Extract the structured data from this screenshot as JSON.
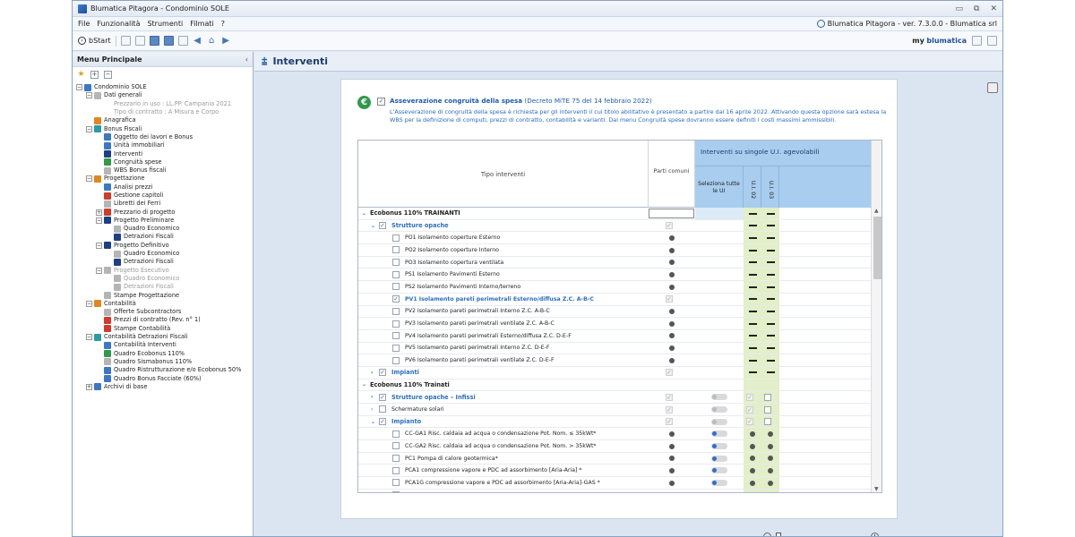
{
  "window": {
    "title": "Blumatica Pitagora - Condominio SOLE"
  },
  "menu": {
    "items": [
      "File",
      "Funzionalità",
      "Strumenti",
      "Filmati",
      "?"
    ],
    "version": "Blumatica Pitagora - ver. 7.3.0.0 - Blumatica srl"
  },
  "toolbar": {
    "bstart": "bStart",
    "my": "my",
    "brand": "blumatica"
  },
  "left_panel": {
    "title": "Menu Principale",
    "tree": [
      {
        "label": "Condominio SOLE",
        "indent": 0,
        "exp": "-",
        "icon": "c-blue"
      },
      {
        "label": "Dati generali",
        "indent": 1,
        "exp": "-",
        "icon": "c-gray"
      },
      {
        "label": "Prezzario in uso : LL.PP. Campania 2021",
        "indent": 3,
        "exp": "",
        "icon": "",
        "dis": true
      },
      {
        "label": "Tipo di contratto : A Misura e Corpo",
        "indent": 3,
        "exp": "",
        "icon": "",
        "dis": true
      },
      {
        "label": "Anagrafica",
        "indent": 1,
        "exp": "",
        "icon": "c-orange"
      },
      {
        "label": "Bonus Fiscali",
        "indent": 1,
        "exp": "-",
        "icon": "c-teal"
      },
      {
        "label": "Oggetto dei lavori e Bonus",
        "indent": 2,
        "exp": "",
        "icon": "c-blue"
      },
      {
        "label": "Unità immobiliari",
        "indent": 2,
        "exp": "",
        "icon": "c-blue"
      },
      {
        "label": "Interventi",
        "indent": 2,
        "exp": "",
        "icon": "c-navy"
      },
      {
        "label": "Congruità spese",
        "indent": 2,
        "exp": "",
        "icon": "c-green"
      },
      {
        "label": "WBS Bonus fiscali",
        "indent": 2,
        "exp": "",
        "icon": "c-gray"
      },
      {
        "label": "Progettazione",
        "indent": 1,
        "exp": "-",
        "icon": "c-orange"
      },
      {
        "label": "Analisi prezzi",
        "indent": 2,
        "exp": "",
        "icon": "c-blue"
      },
      {
        "label": "Gestione capitoli",
        "indent": 2,
        "exp": "",
        "icon": "c-red"
      },
      {
        "label": "Libretti dei Ferri",
        "indent": 2,
        "exp": "",
        "icon": "c-gray"
      },
      {
        "label": "Prezzario di progetto",
        "indent": 2,
        "exp": "+",
        "icon": "c-red"
      },
      {
        "label": "Progetto Preliminare",
        "indent": 2,
        "exp": "-",
        "icon": "c-navy"
      },
      {
        "label": "Quadro Economico",
        "indent": 3,
        "exp": "",
        "icon": "c-gray"
      },
      {
        "label": "Detrazioni Fiscali",
        "indent": 3,
        "exp": "",
        "icon": "c-navy"
      },
      {
        "label": "Progetto Definitivo",
        "indent": 2,
        "exp": "-",
        "icon": "c-navy"
      },
      {
        "label": "Quadro Economico",
        "indent": 3,
        "exp": "",
        "icon": "c-gray"
      },
      {
        "label": "Detrazioni Fiscali",
        "indent": 3,
        "exp": "",
        "icon": "c-navy"
      },
      {
        "label": "Progetto Esecutivo",
        "indent": 2,
        "exp": "-",
        "icon": "c-gray",
        "dis": true
      },
      {
        "label": "Quadro Economico",
        "indent": 3,
        "exp": "",
        "icon": "c-gray",
        "dis": true
      },
      {
        "label": "Detrazioni Fiscali",
        "indent": 3,
        "exp": "",
        "icon": "c-gray",
        "dis": true
      },
      {
        "label": "Stampe Progettazione",
        "indent": 2,
        "exp": "",
        "icon": "c-gray"
      },
      {
        "label": "Contabilità",
        "indent": 1,
        "exp": "-",
        "icon": "c-orange"
      },
      {
        "label": "Offerte Subcontractors",
        "indent": 2,
        "exp": "",
        "icon": "c-gray"
      },
      {
        "label": "Prezzi di contratto (Rev. n° 1)",
        "indent": 2,
        "exp": "",
        "icon": "c-red"
      },
      {
        "label": "Stampe Contabilità",
        "indent": 2,
        "exp": "",
        "icon": "c-red"
      },
      {
        "label": "Contabilità Detrazioni Fiscali",
        "indent": 1,
        "exp": "-",
        "icon": "c-teal"
      },
      {
        "label": "Contabilità Interventi",
        "indent": 2,
        "exp": "",
        "icon": "c-blue"
      },
      {
        "label": "Quadro Ecobonus 110%",
        "indent": 2,
        "exp": "",
        "icon": "c-green"
      },
      {
        "label": "Quadro Sismabonus 110%",
        "indent": 2,
        "exp": "",
        "icon": "c-gray"
      },
      {
        "label": "Quadro Ristrutturazione e/o Ecobonus 50%",
        "indent": 2,
        "exp": "",
        "icon": "c-blue"
      },
      {
        "label": "Quadro Bonus Facciate (60%)",
        "indent": 2,
        "exp": "",
        "icon": "c-blue"
      },
      {
        "label": "Archivi di base",
        "indent": 1,
        "exp": "+",
        "icon": "c-blue"
      }
    ]
  },
  "main": {
    "title": "Interventi",
    "asseverazione": {
      "title_bold": "Asseverazione congruità della spesa",
      "title_rest": " (Decreto MiTE 75 del 14 febbraio 2022)",
      "desc": "L'Asseverazione di congruità della spesa è richiesta per gli interventi il cui titolo abilitativo è presentato a partire dal 16 aprile 2022. Attivando questa opzione sarà estesa la WBS per la definizione di computi, prezzi di contratto, contabilità e varianti. Dal menu Congruità spese dovranno essere definiti i costi massimi ammissibili."
    },
    "grid": {
      "col_tipo": "Tipo interventi",
      "col_parti": "Parti comuni",
      "col_int": "Interventi su singole U.I. agevolabili",
      "col_sel": "Seleziona tutte le UI",
      "col_ui": [
        "U.I. 02",
        "U.I. 03"
      ],
      "rows": [
        {
          "label": "Ecobonus 110% TRAINANTI",
          "type": "sec",
          "caret": "⌄",
          "indent": 0,
          "cb": "",
          "parti": "input",
          "sel": "",
          "ui": [
            "dash",
            "dash"
          ]
        },
        {
          "label": "Strutture opache",
          "type": "grp",
          "caret": "⌄",
          "indent": 10,
          "cb": "✓",
          "parti": "cbdis",
          "sel": "",
          "ui": [
            "dash",
            "dash"
          ]
        },
        {
          "label": "PO1 Isolamento coperture Esterno",
          "type": "item",
          "caret": "",
          "indent": 34,
          "cb": "",
          "parti": "dot",
          "sel": "",
          "ui": [
            "dash",
            "dash"
          ]
        },
        {
          "label": "PO2 Isolamento coperture Interno",
          "type": "item",
          "caret": "",
          "indent": 34,
          "cb": "",
          "parti": "dot",
          "sel": "",
          "ui": [
            "dash",
            "dash"
          ]
        },
        {
          "label": "PO3 Isolamento copertura ventilata",
          "type": "item",
          "caret": "",
          "indent": 34,
          "cb": "",
          "parti": "dot",
          "sel": "",
          "ui": [
            "dash",
            "dash"
          ]
        },
        {
          "label": "PS1 Isolamento Pavimenti Esterno",
          "type": "item",
          "caret": "",
          "indent": 34,
          "cb": "",
          "parti": "dot",
          "sel": "",
          "ui": [
            "dash",
            "dash"
          ]
        },
        {
          "label": "PS2 Isolamento Pavimenti Interno/terreno",
          "type": "item",
          "caret": "",
          "indent": 34,
          "cb": "",
          "parti": "dot",
          "sel": "",
          "ui": [
            "dash",
            "dash"
          ]
        },
        {
          "label": "PV1 Isolamento pareti perimetrali Esterno/diffusa Z.C. A-B-C",
          "type": "hl",
          "caret": "",
          "indent": 34,
          "cb": "✓",
          "parti": "cbdis",
          "sel": "",
          "ui": [
            "dash",
            "dash"
          ]
        },
        {
          "label": "PV2 Isolamento pareti perimetrali Interno Z.C. A-B-C",
          "type": "item",
          "caret": "",
          "indent": 34,
          "cb": "",
          "parti": "dot",
          "sel": "",
          "ui": [
            "dash",
            "dash"
          ]
        },
        {
          "label": "PV3 Isolamento pareti perimetrali ventilate Z.C. A-B-C",
          "type": "item",
          "caret": "",
          "indent": 34,
          "cb": "",
          "parti": "dot",
          "sel": "",
          "ui": [
            "dash",
            "dash"
          ]
        },
        {
          "label": "PV4 Isolamento pareti perimetrali Esterno/diffusa Z.C. D-E-F",
          "type": "item",
          "caret": "",
          "indent": 34,
          "cb": "",
          "parti": "dot",
          "sel": "",
          "ui": [
            "dash",
            "dash"
          ]
        },
        {
          "label": "PV5 Isolamento pareti perimetrali Interno Z.C. D-E-F",
          "type": "item",
          "caret": "",
          "indent": 34,
          "cb": "",
          "parti": "dot",
          "sel": "",
          "ui": [
            "dash",
            "dash"
          ]
        },
        {
          "label": "PV6 Isolamento pareti perimetrali ventilate Z.C. D-E-F",
          "type": "item",
          "caret": "",
          "indent": 34,
          "cb": "",
          "parti": "dot",
          "sel": "",
          "ui": [
            "dash",
            "dash"
          ]
        },
        {
          "label": "Impianti",
          "type": "grp",
          "caret": "›",
          "indent": 10,
          "cb": "✓",
          "parti": "cbdis",
          "sel": "",
          "ui": [
            "dash",
            "dash"
          ]
        },
        {
          "label": "Ecobonus 110% Trainati",
          "type": "sec",
          "caret": "⌄",
          "indent": 0,
          "cb": "",
          "parti": "",
          "sel": "",
          "ui": [
            "",
            ""
          ]
        },
        {
          "label": "Strutture opache – Infissi",
          "type": "grp",
          "caret": "›",
          "indent": 10,
          "cb": "✓",
          "parti": "cbdis",
          "sel": "togoff",
          "ui": [
            "cbdis",
            "cb"
          ]
        },
        {
          "label": "Schermature solari",
          "type": "item",
          "caret": "›",
          "indent": 10,
          "cb": "",
          "parti": "cbdis",
          "sel": "togoff",
          "ui": [
            "cbdis",
            "cb"
          ]
        },
        {
          "label": "Impianto",
          "type": "grp",
          "caret": "⌄",
          "indent": 10,
          "cb": "✓",
          "parti": "cbdis",
          "sel": "togoff",
          "ui": [
            "cbdis",
            "cb"
          ]
        },
        {
          "label": "CC-GA1 Risc. caldaia ad acqua o condensazione Pot. Nom. ≤ 35kWt*",
          "type": "item",
          "caret": "",
          "indent": 34,
          "cb": "",
          "parti": "dot",
          "sel": "tog",
          "ui": [
            "dot",
            "dot"
          ]
        },
        {
          "label": "CC-GA2 Risc. caldaia ad acqua o condensazione Pot. Nom. > 35kWt*",
          "type": "item",
          "caret": "",
          "indent": 34,
          "cb": "",
          "parti": "dot",
          "sel": "tog",
          "ui": [
            "dot",
            "dot"
          ]
        },
        {
          "label": "PC1 Pompa di calore geotermica*",
          "type": "item",
          "caret": "",
          "indent": 34,
          "cb": "",
          "parti": "dot",
          "sel": "tog",
          "ui": [
            "dot",
            "dot"
          ]
        },
        {
          "label": "PCA1 compressione vapore e PDC ad assorbimento [Aria-Aria] *",
          "type": "item",
          "caret": "",
          "indent": 34,
          "cb": "",
          "parti": "dot",
          "sel": "tog",
          "ui": [
            "dot",
            "dot"
          ]
        },
        {
          "label": "PCA1G compressione vapore e PDC ad assorbimento [Aria-Aria]-GAS *",
          "type": "item",
          "caret": "",
          "indent": 34,
          "cb": "",
          "parti": "dot",
          "sel": "tog",
          "ui": [
            "dot",
            "dot"
          ]
        },
        {
          "label": "",
          "type": "item",
          "caret": "",
          "indent": 34,
          "cb": "",
          "parti": "dot",
          "sel": "tog",
          "ui": [
            "dot",
            "dot"
          ]
        }
      ]
    }
  }
}
